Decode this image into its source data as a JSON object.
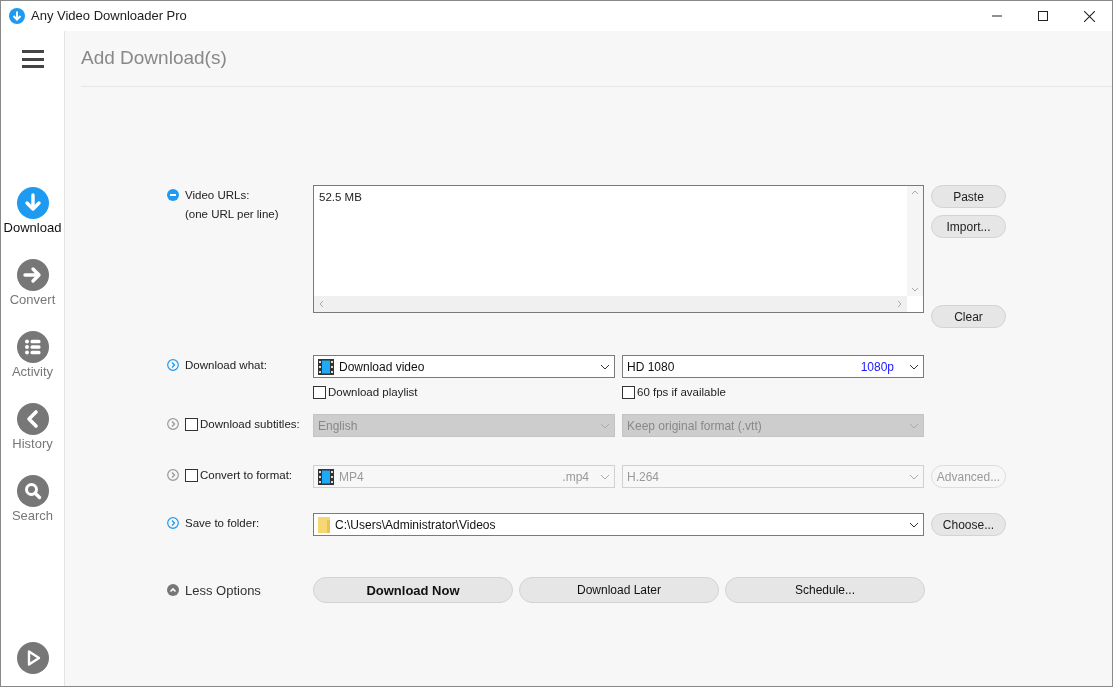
{
  "window": {
    "title": "Any Video Downloader Pro"
  },
  "sidebar": {
    "items": [
      {
        "kind": "download",
        "label": "Download",
        "selected": true
      },
      {
        "kind": "convert",
        "label": "Convert",
        "selected": false
      },
      {
        "kind": "activity",
        "label": "Activity",
        "selected": false
      },
      {
        "kind": "history",
        "label": "History",
        "selected": false
      },
      {
        "kind": "search",
        "label": "Search",
        "selected": false
      }
    ]
  },
  "page_title": "Add Download(s)",
  "urls": {
    "label": "Video URLs:",
    "hint": "(one URL per line)",
    "value": "52.5 MB",
    "buttons": [
      "Paste",
      "Import...",
      "Clear"
    ]
  },
  "download_what": {
    "label": "Download what:",
    "type": {
      "value": "Download video"
    },
    "quality": {
      "value": "HD 1080",
      "tag": "1080p"
    },
    "playlist": {
      "label": "Download playlist",
      "checked": false
    },
    "fps60": {
      "label": "60 fps if available",
      "checked": false
    }
  },
  "subtitles": {
    "label": "Download subtitles:",
    "checked": false,
    "language": {
      "value": "English",
      "disabled": true
    },
    "format": {
      "value": "Keep original format (.vtt)",
      "disabled": true
    }
  },
  "convert": {
    "label": "Convert to format:",
    "checked": false,
    "format": {
      "value": "MP4",
      "ext": ".mp4",
      "disabled": true
    },
    "codec": {
      "value": "H.264",
      "disabled": true
    },
    "advanced": {
      "label": "Advanced...",
      "disabled": true
    }
  },
  "save": {
    "label": "Save to folder:",
    "path": "C:\\Users\\Administrator\\Videos",
    "button": "Choose..."
  },
  "footer": {
    "toggle": "Less Options",
    "buttons": [
      {
        "label": "Download Now",
        "kind": "primary"
      },
      {
        "label": "Download Later",
        "kind": "normal"
      },
      {
        "label": "Schedule...",
        "kind": "normal"
      }
    ]
  }
}
